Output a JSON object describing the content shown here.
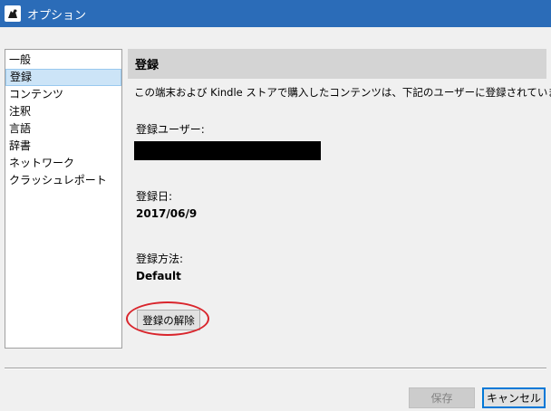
{
  "window": {
    "title": "オプション",
    "icon": "kindle-reader-icon"
  },
  "sidebar": {
    "items": [
      {
        "label": "一般",
        "selected": false
      },
      {
        "label": "登録",
        "selected": true
      },
      {
        "label": "コンテンツ",
        "selected": false
      },
      {
        "label": "注釈",
        "selected": false
      },
      {
        "label": "言語",
        "selected": false
      },
      {
        "label": "辞書",
        "selected": false
      },
      {
        "label": "ネットワーク",
        "selected": false
      },
      {
        "label": "クラッシュレポート",
        "selected": false
      }
    ]
  },
  "main": {
    "header": "登録",
    "description": "この端末および Kindle ストアで購入したコンテンツは、下記のユーザーに登録されています。",
    "user_label": "登録ユーザー:",
    "date_label": "登録日:",
    "date_value": "2017/06/9",
    "method_label": "登録方法:",
    "method_value": "Default",
    "deregister_label": "登録の解除"
  },
  "footer": {
    "save_label": "保存",
    "cancel_label": "キャンセル"
  },
  "colors": {
    "titlebar": "#2b6cb8",
    "selection": "#cce4f7",
    "highlight": "#d9252c"
  }
}
